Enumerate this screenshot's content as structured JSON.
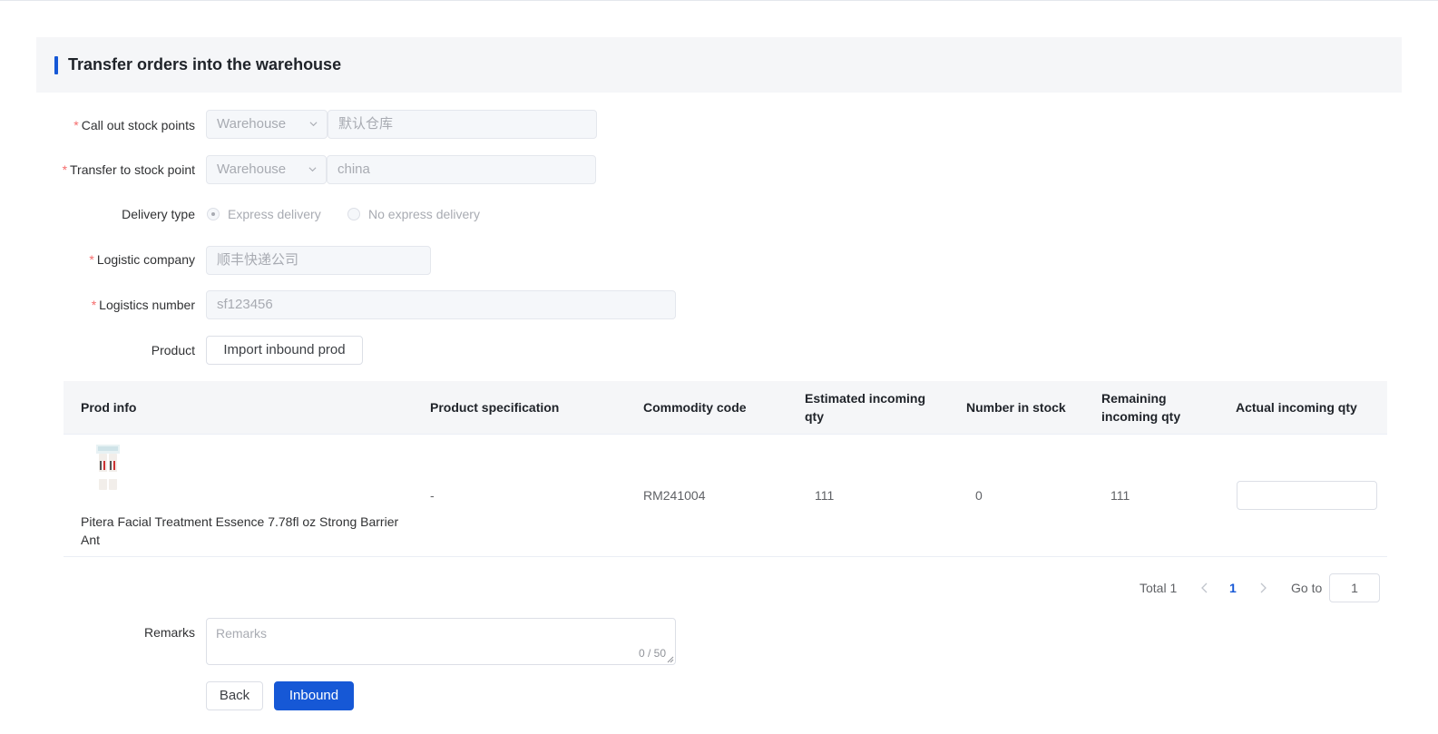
{
  "header": {
    "title": "Transfer orders into the warehouse"
  },
  "form": {
    "required_mark": "*",
    "callout": {
      "label": "Call out stock points",
      "type_value": "Warehouse",
      "warehouse_value": "默认仓库"
    },
    "transfer": {
      "label": "Transfer to stock point",
      "type_value": "Warehouse",
      "warehouse_value": "china"
    },
    "delivery": {
      "label": "Delivery type",
      "options": [
        "Express delivery",
        "No express delivery"
      ],
      "selected": "Express delivery"
    },
    "logistic_company": {
      "label": "Logistic company",
      "value": "顺丰快递公司"
    },
    "logistics_number": {
      "label": "Logistics number",
      "value": "sf123456"
    },
    "product": {
      "label": "Product",
      "import_button": "Import inbound prod"
    },
    "remarks": {
      "label": "Remarks",
      "placeholder": "Remarks",
      "counter": "0 / 50"
    }
  },
  "table": {
    "columns": [
      "Prod info",
      "Product specification",
      "Commodity code",
      "Estimated incoming qty",
      "Number in stock",
      "Remaining incoming qty",
      "Actual incoming qty"
    ],
    "rows": [
      {
        "prod_name": "Pitera Facial Treatment Essence 7.78fl oz Strong Barrier Ant",
        "specification": "-",
        "commodity_code": "RM241004",
        "estimated_qty": "111",
        "in_stock": "0",
        "remaining_qty": "111",
        "actual_qty": ""
      }
    ]
  },
  "pagination": {
    "total": "Total 1",
    "current_page": "1",
    "goto_label": "Go to",
    "goto_value": "1"
  },
  "actions": {
    "back": "Back",
    "inbound": "Inbound"
  },
  "colors": {
    "primary": "#1658d6",
    "required": "#f56c6c",
    "disabled_bg": "#f5f7fa"
  }
}
